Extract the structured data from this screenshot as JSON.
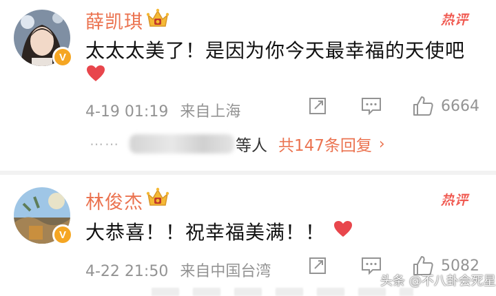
{
  "comments": [
    {
      "username": "薛凯琪",
      "hot_label": "热评",
      "text": "太太太美了！是因为你今天最幸福的天使吧",
      "timestamp": "4-19 01:19",
      "location": "来自上海",
      "likes": "6664",
      "verified_badge": "V",
      "reply_summary": {
        "dots": "⋯⋯",
        "others": "等人",
        "total": "共147条回复",
        "chevron": "›"
      }
    },
    {
      "username": "林俊杰",
      "hot_label": "热评",
      "text": "大恭喜！！祝幸福美满！！",
      "timestamp": "4-22 21:50",
      "location": "来自中国台湾",
      "likes": "5082",
      "verified_badge": "V"
    }
  ],
  "watermark": "头条 @不八卦会死星人",
  "colors": {
    "username": "#eb7350",
    "hot_label": "#f0584f",
    "meta": "#939393",
    "heart": "#e8464c",
    "crown": "#f5b935",
    "verified": "#f5a623"
  },
  "icons": [
    "crown-vip-icon",
    "verified-v-icon",
    "heart-icon",
    "share-icon",
    "comment-icon",
    "like-icon",
    "chevron-right-icon"
  ]
}
